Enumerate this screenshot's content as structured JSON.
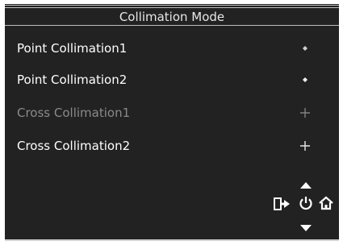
{
  "title": "Collimation Mode",
  "menu": {
    "items": [
      {
        "label": "Point Collimation1",
        "marker": "diamond-marker-icon",
        "enabled": true
      },
      {
        "label": "Point Collimation2",
        "marker": "diamond-marker-icon",
        "enabled": true
      },
      {
        "label": "Cross Collimation1",
        "marker": "cross-marker-icon",
        "enabled": false
      },
      {
        "label": "Cross Collimation2",
        "marker": "cross-marker-icon",
        "enabled": true
      }
    ]
  },
  "controls": {
    "icons": [
      "up-arrow-icon",
      "exit-icon",
      "power-icon",
      "home-icon",
      "down-arrow-icon"
    ]
  },
  "colors": {
    "background": "#222222",
    "text": "#ffffff",
    "disabled_text": "#8a8a8a"
  }
}
